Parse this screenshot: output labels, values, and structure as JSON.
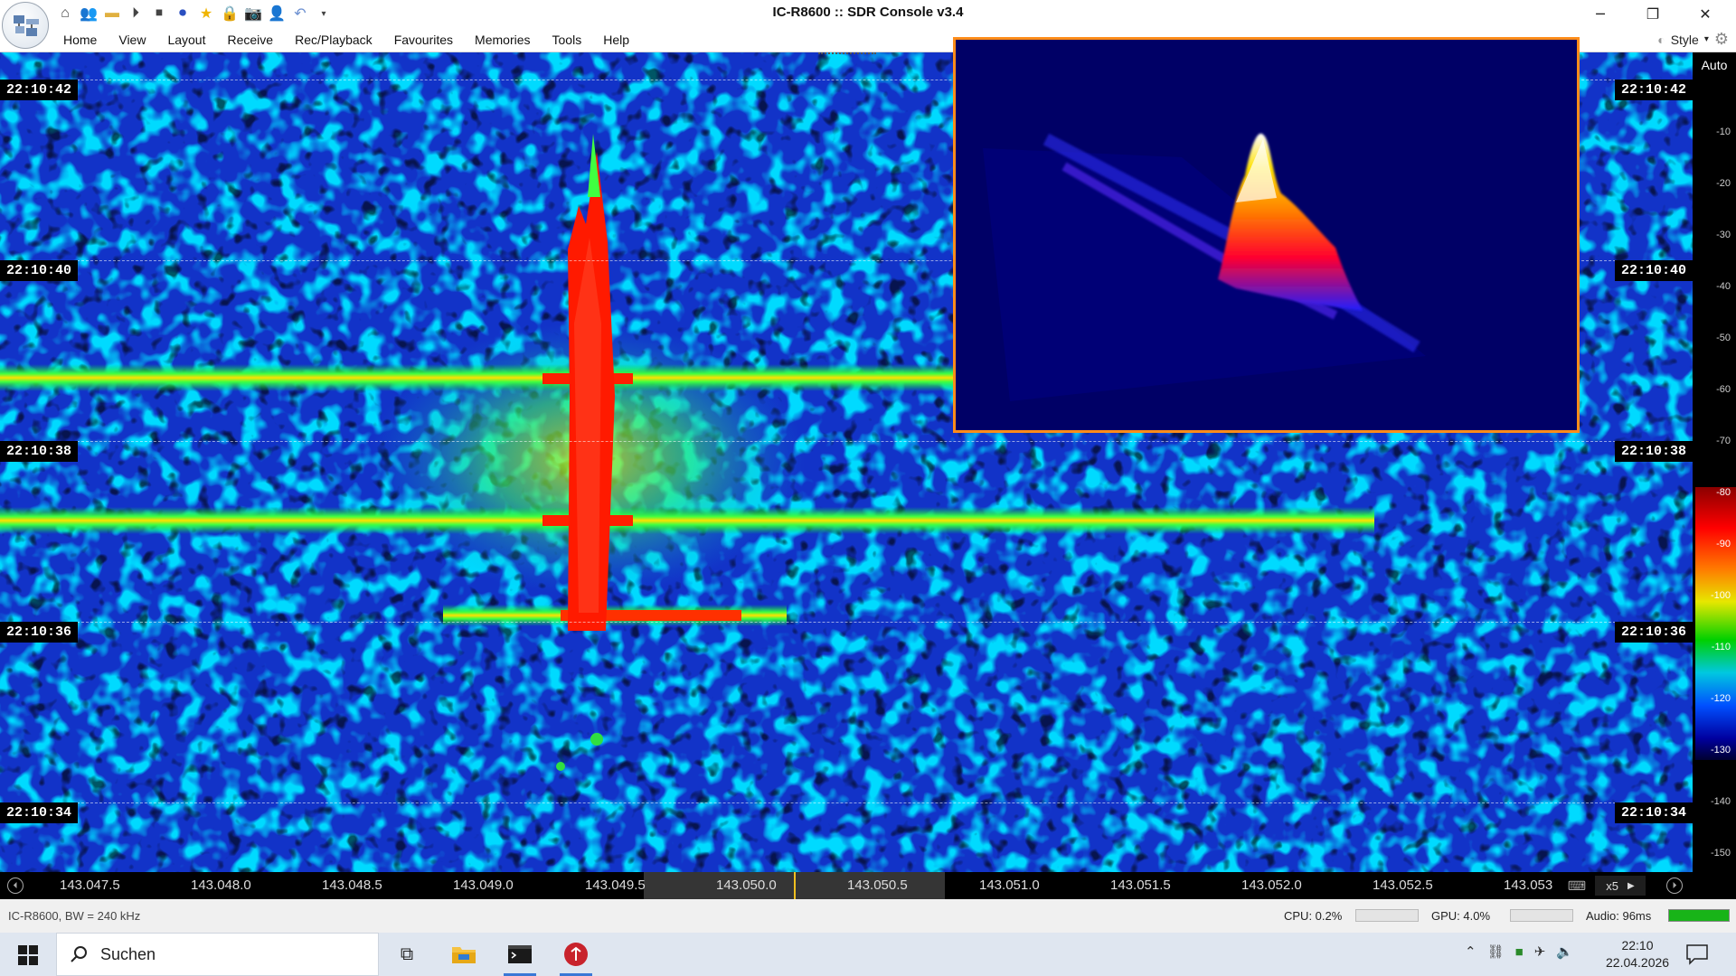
{
  "window": {
    "title": "IC-R8600 :: SDR Console v3.4",
    "minimize_glyph": "─",
    "restore_glyph": "❐",
    "close_glyph": "✕"
  },
  "quick_access_icons": [
    "home-icon",
    "users-icon",
    "folder-icon",
    "play-icon",
    "stop-icon",
    "record-icon",
    "star-icon",
    "lock-icon",
    "camera-icon",
    "user-icon",
    "undo-icon",
    "dropdown-icon"
  ],
  "menu": {
    "items": [
      "Home",
      "View",
      "Layout",
      "Receive",
      "Rec/Playback",
      "Favourites",
      "Memories",
      "Tools",
      "Help"
    ],
    "style_label": "Style"
  },
  "waterfall": {
    "timestamps": [
      "22:10:42",
      "22:10:40",
      "22:10:38",
      "22:10:36",
      "22:10:34"
    ],
    "palette": {
      "background": "#1030c0",
      "noise": "#00b4ff",
      "signal": "#ff0000",
      "halo": "#f0e000"
    }
  },
  "scale": {
    "mode_label": "Auto",
    "ticks": [
      "-10",
      "-20",
      "-30",
      "-40",
      "-50",
      "-60",
      "-70",
      "-80",
      "-90",
      "-100",
      "-110",
      "-120",
      "-130",
      "-140",
      "-150"
    ]
  },
  "freq_axis": {
    "labels": [
      "143.047.5",
      "143.048.0",
      "143.048.5",
      "143.049.0",
      "143.049.5",
      "143.050.0",
      "143.050.5",
      "143.051.0",
      "143.051.5",
      "143.052.0",
      "143.052.5",
      "143.053"
    ],
    "zoom": "x5",
    "center_marker_color": "#f0c020"
  },
  "status": {
    "device": "IC-R8600, BW = 240 kHz",
    "cpu": "CPU: 0.2%",
    "gpu": "GPU: 4.0%",
    "audio": "Audio: 96ms",
    "audio_level": 1.0
  },
  "taskbar": {
    "search_placeholder": "Suchen",
    "time": "22:10",
    "date": "22.04.2026"
  }
}
